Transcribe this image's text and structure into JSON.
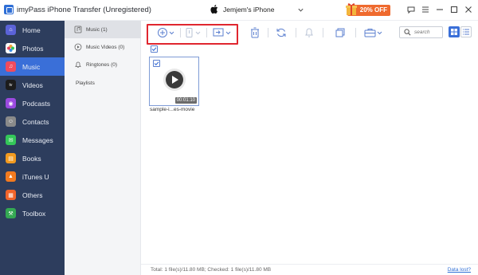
{
  "titlebar": {
    "app_title": "imyPass iPhone Transfer (Unregistered)",
    "device_name": "Jemjem's iPhone",
    "promo_label": "20% OFF"
  },
  "sidebar": {
    "items": [
      {
        "label": "Home",
        "icon": "home-icon",
        "color": "#5b63d8"
      },
      {
        "label": "Photos",
        "icon": "photos-icon",
        "color": "#f2a33a"
      },
      {
        "label": "Music",
        "icon": "music-icon",
        "color": "#f04b5d",
        "active": true
      },
      {
        "label": "Videos",
        "icon": "tv-icon",
        "color": "#1c1c1c"
      },
      {
        "label": "Podcasts",
        "icon": "podcasts-icon",
        "color": "#9b4ae0"
      },
      {
        "label": "Contacts",
        "icon": "contacts-icon",
        "color": "#8a8a8a"
      },
      {
        "label": "Messages",
        "icon": "messages-icon",
        "color": "#34c759"
      },
      {
        "label": "Books",
        "icon": "books-icon",
        "color": "#f29a1f"
      },
      {
        "label": "iTunes U",
        "icon": "itunes-u-icon",
        "color": "#f27a1f"
      },
      {
        "label": "Others",
        "icon": "others-icon",
        "color": "#f2642a"
      },
      {
        "label": "Toolbox",
        "icon": "toolbox-icon",
        "color": "#34a853"
      }
    ]
  },
  "subpanel": {
    "items": [
      {
        "label": "Music (1)",
        "active": true
      },
      {
        "label": "Music Videos (0)"
      },
      {
        "label": "Ringtones (0)"
      }
    ],
    "playlists_label": "Playlists"
  },
  "search": {
    "placeholder": "search"
  },
  "content": {
    "file_name": "sample-i...es-movie",
    "duration": "00:01:10"
  },
  "status": {
    "summary": "Total: 1 file(s)/11.80 MB; Checked: 1 file(s)/11.80 MB",
    "data_lost_link": "Data lost?"
  },
  "colors": {
    "sidebar_bg": "#2d3d5d",
    "accent": "#3a6fd8",
    "highlight": "#e0262f",
    "promo": "#ef6a2e"
  }
}
